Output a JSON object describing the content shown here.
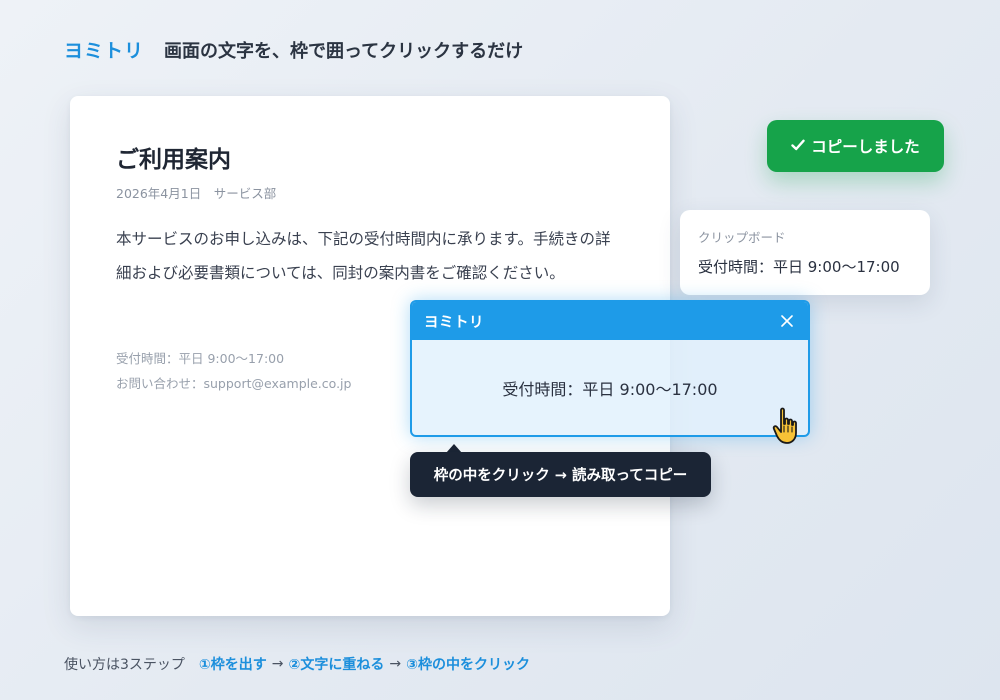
{
  "header": {
    "brand": "ヨミトリ",
    "tagline": "画面の文字を、枠で囲ってクリックするだけ"
  },
  "document": {
    "title": "ご利用案内",
    "meta": "2026年4月1日　サービス部",
    "body": "本サービスのお申し込みは、下記の受付時間内に承ります。手続きの詳細および必要書類については、同封の案内書をご確認ください。",
    "hours": "受付時間：平日 9:00〜17:00",
    "contact": "お問い合わせ：support@example.co.jp"
  },
  "toast": {
    "icon": "check-icon",
    "label": "コピーしました",
    "color": "#16a34a"
  },
  "clipboard": {
    "label": "クリップボード",
    "value": "受付時間：平日 9:00〜17:00"
  },
  "capture": {
    "title": "ヨミトリ",
    "close_icon": "close-icon",
    "captured_text": "受付時間：平日 9:00〜17:00",
    "accent": "#1e9be8"
  },
  "tooltip": {
    "text": "枠の中をクリック → 読み取ってコピー"
  },
  "footer": {
    "intro": "使い方は3ステップ",
    "steps": [
      "①枠を出す",
      "②文字に重ねる",
      "③枠の中をクリック"
    ],
    "separator": "→"
  }
}
